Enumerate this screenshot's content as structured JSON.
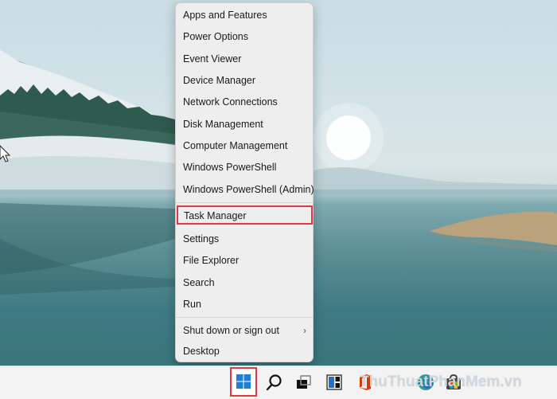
{
  "context_menu": {
    "items": [
      {
        "label": "Apps and Features"
      },
      {
        "label": "Power Options"
      },
      {
        "label": "Event Viewer"
      },
      {
        "label": "Device Manager"
      },
      {
        "label": "Network Connections"
      },
      {
        "label": "Disk Management"
      },
      {
        "label": "Computer Management"
      },
      {
        "label": "Windows PowerShell"
      },
      {
        "label": "Windows PowerShell (Admin)"
      },
      {
        "label": "Task Manager",
        "highlighted": true
      },
      {
        "label": "Settings"
      },
      {
        "label": "File Explorer"
      },
      {
        "label": "Search"
      },
      {
        "label": "Run"
      },
      {
        "label": "Shut down or sign out",
        "has_submenu": true
      },
      {
        "label": "Desktop"
      }
    ],
    "submenu_chevron": "›"
  },
  "taskbar": {
    "icons": [
      "windows-start-icon",
      "search-icon",
      "task-view-icon",
      "widgets-icon",
      "office-icon",
      "edge-icon",
      "store-icon"
    ],
    "watermark": "ThuThuatPhanMem.vn"
  },
  "colors": {
    "highlight_border": "#e0393f",
    "menu_background": "#eeeeee",
    "taskbar_background": "#f3f3f3",
    "windows_blue": "#1f7fd6"
  }
}
